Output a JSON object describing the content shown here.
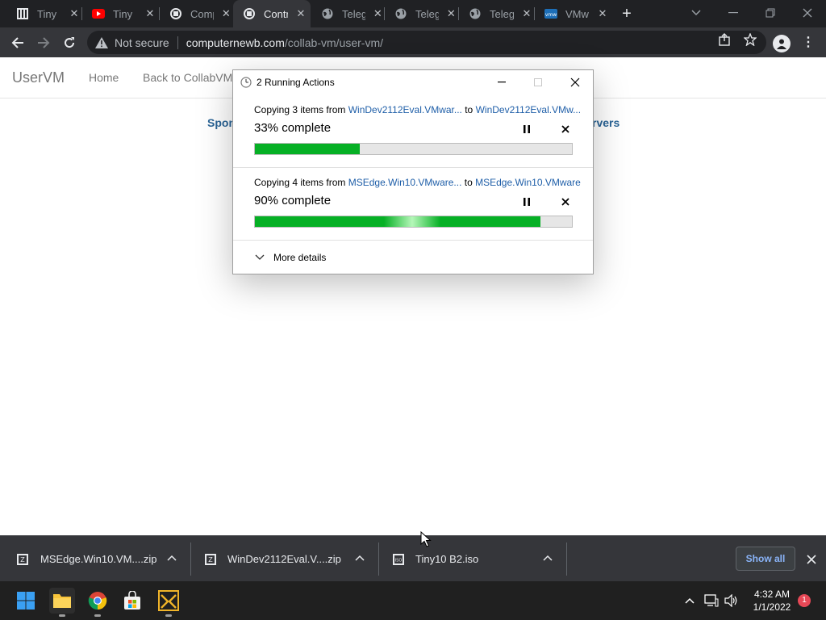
{
  "browser": {
    "tabs": [
      {
        "title": "Tiny",
        "icon": "tinyurl-icon"
      },
      {
        "title": "Tiny",
        "icon": "youtube-icon"
      },
      {
        "title": "Comp",
        "icon": "computernewb-icon"
      },
      {
        "title": "Contr",
        "icon": "computernewb-icon",
        "active": true
      },
      {
        "title": "Teleg",
        "icon": "globe-icon"
      },
      {
        "title": "Teleg",
        "icon": "globe-icon"
      },
      {
        "title": "Teleg",
        "icon": "globe-icon"
      },
      {
        "title": "VMw",
        "icon": "vmware-icon"
      }
    ],
    "security_label": "Not secure",
    "url_host": "computernewb.com",
    "url_path": "/collab-vm/user-vm/"
  },
  "site": {
    "brand": "UserVM",
    "nav": [
      "Home",
      "Back to CollabVM"
    ],
    "link_left": "Spon",
    "link_right": "rvers"
  },
  "dialog": {
    "title": "2 Running Actions",
    "operations": [
      {
        "prefix": "Copying 3 items from ",
        "from": "WinDev2112Eval.VMwar...",
        "mid": " to ",
        "to": "WinDev2112Eval.VMw...",
        "percent_label": "33% complete",
        "progress": 33
      },
      {
        "prefix": "Copying 4 items from ",
        "from": "MSEdge.Win10.VMware...",
        "mid": " to ",
        "to": "MSEdge.Win10.VMware",
        "percent_label": "90% complete",
        "progress": 90
      }
    ],
    "more_details": "More details"
  },
  "downloads": {
    "items": [
      {
        "name": "MSEdge.Win10.VM....zip",
        "icon": "zip-file-icon"
      },
      {
        "name": "WinDev2112Eval.V....zip",
        "icon": "zip-file-icon"
      },
      {
        "name": "Tiny10 B2.iso",
        "icon": "iso-file-icon"
      }
    ],
    "show_all": "Show all"
  },
  "taskbar": {
    "time": "4:32 AM",
    "date": "1/1/2022",
    "notifications": "1"
  },
  "colors": {
    "progress_green": "#06b025",
    "link_blue": "#1e5ea8",
    "chrome_dark": "#202124",
    "chrome_toolbar": "#35363a"
  }
}
